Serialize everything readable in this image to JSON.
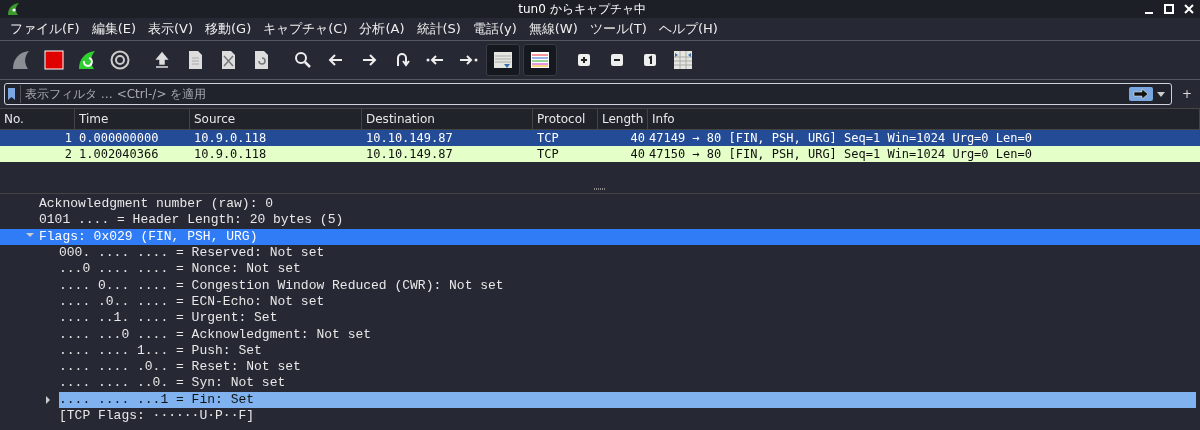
{
  "window": {
    "title": "tun0 からキャプチャ中"
  },
  "menu": [
    "ファイル(F)",
    "編集(E)",
    "表示(V)",
    "移動(G)",
    "キャプチャ(C)",
    "分析(A)",
    "統計(S)",
    "電話(y)",
    "無線(W)",
    "ツール(T)",
    "ヘルプ(H)"
  ],
  "toolbar": [
    {
      "kind": "shark"
    },
    {
      "kind": "stop"
    },
    {
      "kind": "restart"
    },
    {
      "kind": "gear"
    },
    {
      "kind": "sep"
    },
    {
      "kind": "upload"
    },
    {
      "kind": "file"
    },
    {
      "kind": "filex"
    },
    {
      "kind": "filereload"
    },
    {
      "kind": "sep"
    },
    {
      "kind": "search"
    },
    {
      "kind": "left"
    },
    {
      "kind": "right"
    },
    {
      "kind": "jump"
    },
    {
      "kind": "first"
    },
    {
      "kind": "last"
    },
    {
      "kind": "autoscroll",
      "on": true
    },
    {
      "kind": "colorize",
      "on": true
    },
    {
      "kind": "sep"
    },
    {
      "kind": "plus"
    },
    {
      "kind": "minus"
    },
    {
      "kind": "one"
    },
    {
      "kind": "columns"
    }
  ],
  "filter": {
    "placeholder": "表示フィルタ … <Ctrl-/> を適用",
    "add": "+"
  },
  "packet_list": {
    "columns": [
      "No.",
      "Time",
      "Source",
      "Destination",
      "Protocol",
      "Length",
      "Info"
    ],
    "rows": [
      {
        "selected": true,
        "cells": [
          "1",
          "0.000000000",
          "10.9.0.118",
          "10.10.149.87",
          "TCP",
          "40",
          "47149 → 80 [FIN, PSH, URG] Seq=1 Win=1024 Urg=0 Len=0"
        ]
      },
      {
        "selected": false,
        "color": "#e4ffc7",
        "cells": [
          "2",
          "1.002040366",
          "10.9.0.118",
          "10.10.149.87",
          "TCP",
          "40",
          "47150 → 80 [FIN, PSH, URG] Seq=1 Win=1024 Urg=0 Len=0"
        ]
      }
    ]
  },
  "details": [
    {
      "text": "Acknowledgment number (raw): 0",
      "kind": "leaf",
      "selected": false,
      "highlighted": false
    },
    {
      "text": "0101 .... = Header Length: 20 bytes (5)",
      "kind": "leaf",
      "selected": false,
      "highlighted": false
    },
    {
      "text": "Flags: 0x029 (FIN, PSH, URG)",
      "kind": "branch",
      "expanded": true,
      "selected": true,
      "highlighted": false,
      "children": [
        {
          "text": "000. .... .... = Reserved: Not set",
          "kind": "leaf",
          "selected": false,
          "highlighted": false
        },
        {
          "text": "...0 .... .... = Nonce: Not set",
          "kind": "leaf",
          "selected": false,
          "highlighted": false
        },
        {
          "text": ".... 0... .... = Congestion Window Reduced (CWR): Not set",
          "kind": "leaf",
          "selected": false,
          "highlighted": false
        },
        {
          "text": ".... .0.. .... = ECN-Echo: Not set",
          "kind": "leaf",
          "selected": false,
          "highlighted": false
        },
        {
          "text": ".... ..1. .... = Urgent: Set",
          "kind": "leaf",
          "selected": false,
          "highlighted": false
        },
        {
          "text": ".... ...0 .... = Acknowledgment: Not set",
          "kind": "leaf",
          "selected": false,
          "highlighted": false
        },
        {
          "text": ".... .... 1... = Push: Set",
          "kind": "leaf",
          "selected": false,
          "highlighted": false
        },
        {
          "text": ".... .... .0.. = Reset: Not set",
          "kind": "leaf",
          "selected": false,
          "highlighted": false
        },
        {
          "text": ".... .... ..0. = Syn: Not set",
          "kind": "leaf",
          "selected": false,
          "highlighted": false
        },
        {
          "text": ".... .... ...1 = Fin: Set",
          "kind": "branch",
          "expanded": false,
          "selected": false,
          "highlighted": true
        },
        {
          "text": "[TCP Flags: ······U·P··F]",
          "kind": "leaf",
          "selected": false,
          "highlighted": false
        }
      ]
    }
  ]
}
